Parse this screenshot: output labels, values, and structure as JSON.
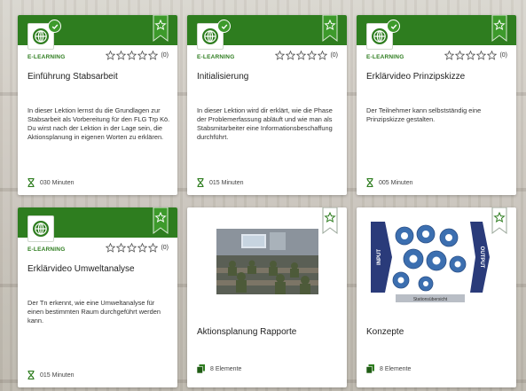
{
  "colors": {
    "brand_green": "#2e7d1f",
    "check_green": "#3d9a2b",
    "star_outline": "#555555"
  },
  "cards": [
    {
      "type": "E-LEARNING",
      "rating_count": "(0)",
      "title": "Einführung Stabsarbeit",
      "description": "In dieser Lektion lernst du die Grundlagen zur Stabsarbeit als Vorbereitung für den FLG Trp Kö. Du wirst nach der Lektion in der Lage sein, die Aktionsplanung in eigenen Worten zu erklären.",
      "duration": "030 Minuten",
      "completed": true
    },
    {
      "type": "E-LEARNING",
      "rating_count": "(0)",
      "title": "Initialisierung",
      "description": "In dieser Lektion wird dir erklärt, wie die Phase der Problemerfassung abläuft und wie man als Stabsmitarbeiter eine Informationsbeschaffung durchführt.",
      "duration": "015 Minuten",
      "completed": true
    },
    {
      "type": "E-LEARNING",
      "rating_count": "(0)",
      "title": "Erklärvideo Prinzipskizze",
      "description": "Der Teilnehmer kann selbstständig eine Prinzipskizze gestalten.",
      "duration": "005 Minuten",
      "completed": true
    },
    {
      "type": "E-LEARNING",
      "rating_count": "(0)",
      "title": "Erklärvideo Umweltanalyse",
      "description": "Der Tn erkennt, wie eine Umweltanalyse für einen bestimmten Raum durchgeführt werden kann.",
      "duration": "015 Minuten",
      "completed": false
    },
    {
      "title": "Aktionsplanung Rapporte",
      "elements": "8 Elemente"
    },
    {
      "title": "Konzepte",
      "elements": "8 Elemente",
      "diagram": {
        "input": "INPUT",
        "output": "OUTPUT",
        "bottom": "Stationsübersicht"
      }
    }
  ],
  "icons": {
    "globe": "globe-icon",
    "check": "check-icon",
    "bookmark": "bookmark-star-icon",
    "star": "star-outline-icon",
    "hourglass": "hourglass-icon",
    "elements": "documents-icon"
  }
}
